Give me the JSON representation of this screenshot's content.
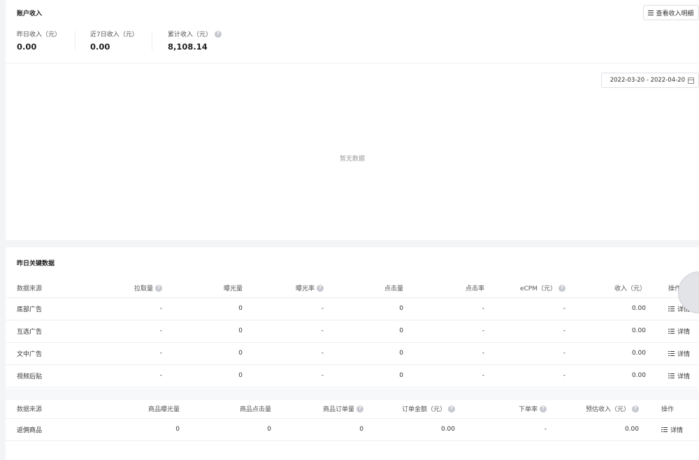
{
  "income": {
    "title": "账户收入",
    "detail_button": "查看收入明细",
    "stats": [
      {
        "label": "昨日收入（元）",
        "value": "0.00"
      },
      {
        "label": "近7日收入（元）",
        "value": "0.00"
      },
      {
        "label": "累计收入（元）",
        "value": "8,108.14"
      }
    ],
    "date_range": "2022-03-20 - 2022-04-20",
    "empty_text": "暂无数据"
  },
  "key": {
    "title": "昨日关键数据",
    "ad_table": {
      "headers": [
        "数据来源",
        "拉取量",
        "曝光量",
        "曝光率",
        "点击量",
        "点击率",
        "eCPM（元）",
        "收入（元）",
        "操作"
      ],
      "rows": [
        {
          "source": "底部广告",
          "pull": "-",
          "exposure": "0",
          "exposure_rate": "-",
          "clicks": "0",
          "ctr": "-",
          "ecpm": "-",
          "income": "0.00",
          "action": "详情"
        },
        {
          "source": "互选广告",
          "pull": "-",
          "exposure": "0",
          "exposure_rate": "-",
          "clicks": "0",
          "ctr": "-",
          "ecpm": "-",
          "income": "0.00",
          "action": "详情"
        },
        {
          "source": "文中广告",
          "pull": "-",
          "exposure": "0",
          "exposure_rate": "-",
          "clicks": "0",
          "ctr": "-",
          "ecpm": "-",
          "income": "0.00",
          "action": "详情"
        },
        {
          "source": "视频后贴",
          "pull": "-",
          "exposure": "0",
          "exposure_rate": "-",
          "clicks": "0",
          "ctr": "-",
          "ecpm": "-",
          "income": "0.00",
          "action": "详情"
        }
      ]
    },
    "goods_table": {
      "headers": [
        "数据来源",
        "商品曝光量",
        "商品点击量",
        "商品订单量",
        "订单金额（元）",
        "下单率",
        "预估收入（元）",
        "操作"
      ],
      "rows": [
        {
          "source": "返佣商品",
          "exposure": "0",
          "clicks": "0",
          "orders": "0",
          "amount": "0.00",
          "order_rate": "-",
          "income": "0.00",
          "action": "详情"
        }
      ]
    }
  },
  "icons": {
    "help": "question-circle-icon",
    "menu": "menu-icon",
    "calendar": "calendar-icon",
    "list": "list-icon"
  },
  "colors": {
    "background": "#f3f4f6",
    "card": "#ffffff",
    "border": "#eceef2",
    "muted": "#999999"
  }
}
